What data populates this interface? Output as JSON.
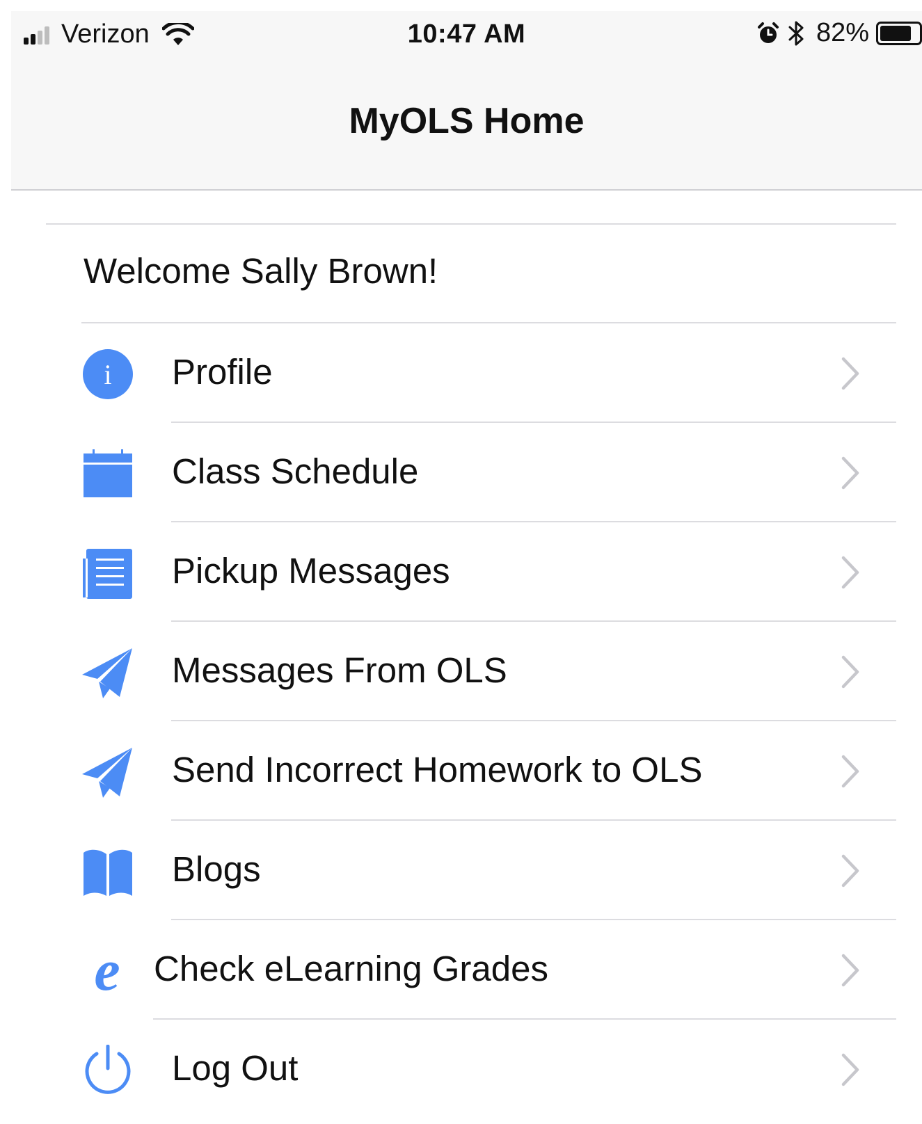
{
  "status_bar": {
    "carrier": "Verizon",
    "time": "10:47 AM",
    "battery_percent": "82%",
    "battery_level": 0.82,
    "signal_bars": 2,
    "icons": [
      "signal-icon",
      "wifi-icon",
      "alarm-icon",
      "bluetooth-icon",
      "battery-icon"
    ]
  },
  "nav": {
    "title": "MyOLS Home"
  },
  "welcome": "Welcome Sally Brown!",
  "menu": [
    {
      "label": "Profile",
      "icon": "info-icon"
    },
    {
      "label": "Class Schedule",
      "icon": "calendar-icon"
    },
    {
      "label": "Pickup Messages",
      "icon": "notepad-icon"
    },
    {
      "label": "Messages From OLS",
      "icon": "paper-plane-icon"
    },
    {
      "label": "Send Incorrect Homework to OLS",
      "icon": "paper-plane-icon"
    },
    {
      "label": "Blogs",
      "icon": "book-icon"
    },
    {
      "label": "Check eLearning Grades",
      "icon": "elearning-icon"
    },
    {
      "label": "Log Out",
      "icon": "power-icon"
    }
  ],
  "colors": {
    "accent": "#4c8cf5",
    "chevron": "#c7c7cc",
    "separator": "#dcdce0",
    "bar_background": "#f7f7f7"
  }
}
